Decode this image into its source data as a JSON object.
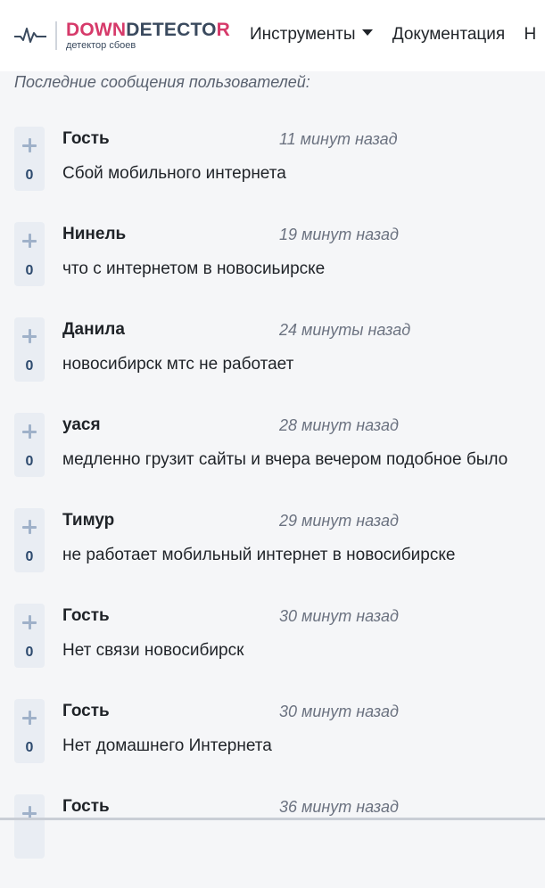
{
  "header": {
    "brand_down": "DOWN",
    "brand_mid": "DETECTO",
    "brand_end": "R",
    "tagline": "детектор сбоев",
    "nav": [
      {
        "label": "Инструменты",
        "dropdown": true
      },
      {
        "label": "Документация",
        "dropdown": false
      },
      {
        "label": "Н",
        "dropdown": false
      }
    ]
  },
  "section_title": "Последние сообщения пользователей:",
  "messages": [
    {
      "author": "Гость",
      "time": "11 минут назад",
      "text": "Сбой мобильного интернета",
      "votes": "0"
    },
    {
      "author": "Нинель",
      "time": "19 минут назад",
      "text": "что с интернетом в новосиьирске",
      "votes": "0"
    },
    {
      "author": "Данила",
      "time": "24 минуты назад",
      "text": "новосибирск мтс не работает",
      "votes": "0"
    },
    {
      "author": "уася",
      "time": "28 минут назад",
      "text": "медленно грузит сайты и вчера вечером подобное было",
      "votes": "0"
    },
    {
      "author": "Тимур",
      "time": "29 минут назад",
      "text": "не работает мобильный интернет в новосибирске",
      "votes": "0"
    },
    {
      "author": "Гость",
      "time": "30 минут назад",
      "text": "Нет связи новосибирск",
      "votes": "0"
    },
    {
      "author": "Гость",
      "time": "30 минут назад",
      "text": "Нет домашнего Интернета",
      "votes": "0"
    },
    {
      "author": "Гость",
      "time": "36 минут назад",
      "text": "",
      "votes": ""
    }
  ],
  "colors": {
    "brand_accent": "#d63a6a",
    "brand_dark": "#3a4a5e",
    "page_bg": "#f5f6f8",
    "vote_bg": "#e9edf3"
  }
}
